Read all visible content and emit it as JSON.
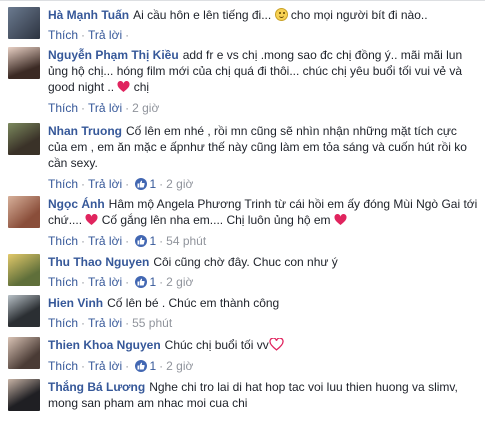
{
  "labels": {
    "like": "Thích",
    "reply": "Trả lời",
    "sep": "·"
  },
  "comments": [
    {
      "name": "Hà Mạnh Tuấn",
      "text_before": "Ai cầu hôn e lên tiếng đi...",
      "text_after": " cho mọi người bít đi nào..",
      "likes": "",
      "time": ""
    },
    {
      "name": "Nguyễn Phạm Thị Kiều",
      "text_before": "add fr e vs chị .mong sao đc chị đồng ý.. mãi mãi lun ủng hộ chị... hóng film mới của chị quá đi thôi... chúc chị yêu buổi tối vui vẻ và good night ..",
      "text_after": "chị",
      "likes": "",
      "time": "2 giờ"
    },
    {
      "name": "Nhan Truong",
      "text_before": "Cố lên em nhé , rồi mn cũng sẽ nhìn nhận những mặt tích cực của em , em ăn mặc e ấpnhư thế này cũng làm em tỏa sáng và cuốn hút rồi ko cần sexy.",
      "text_after": "",
      "likes": "1",
      "time": "2 giờ"
    },
    {
      "name": "Ngọc Ánh",
      "text_before": "Hâm mộ Angela Phương Trinh từ cái hồi em ấy đóng Mùi Ngò Gai tới chứ....",
      "text_mid": " Cố gắng lên nha em.... Chị luôn ủng hộ em ",
      "text_after": "",
      "likes": "1",
      "time": "54 phút"
    },
    {
      "name": "Thu Thao Nguyen",
      "text_before": "Côi cũng chờ đây. Chuc con như ý",
      "text_after": "",
      "likes": "1",
      "time": "2 giờ"
    },
    {
      "name": "Hien Vinh",
      "text_before": "Cố lên bé . Chúc em thành công",
      "text_after": "",
      "likes": "",
      "time": "55 phút"
    },
    {
      "name": "Thien Khoa Nguyen",
      "text_before": "Chúc chị buổi tối vv",
      "text_after": "",
      "likes": "1",
      "time": "2 giờ"
    },
    {
      "name": "Thắng Bá Lương",
      "text_before": "Nghe chi tro lai di hat hop tac voi luu thien huong va slimv, mong san pham am nhac moi cua chi",
      "text_after": "",
      "likes": "",
      "time": ""
    }
  ],
  "colors": {
    "name": "#365899",
    "meta": "#90949c",
    "heart": "#e0245e",
    "like_badge": "#4267b2"
  }
}
